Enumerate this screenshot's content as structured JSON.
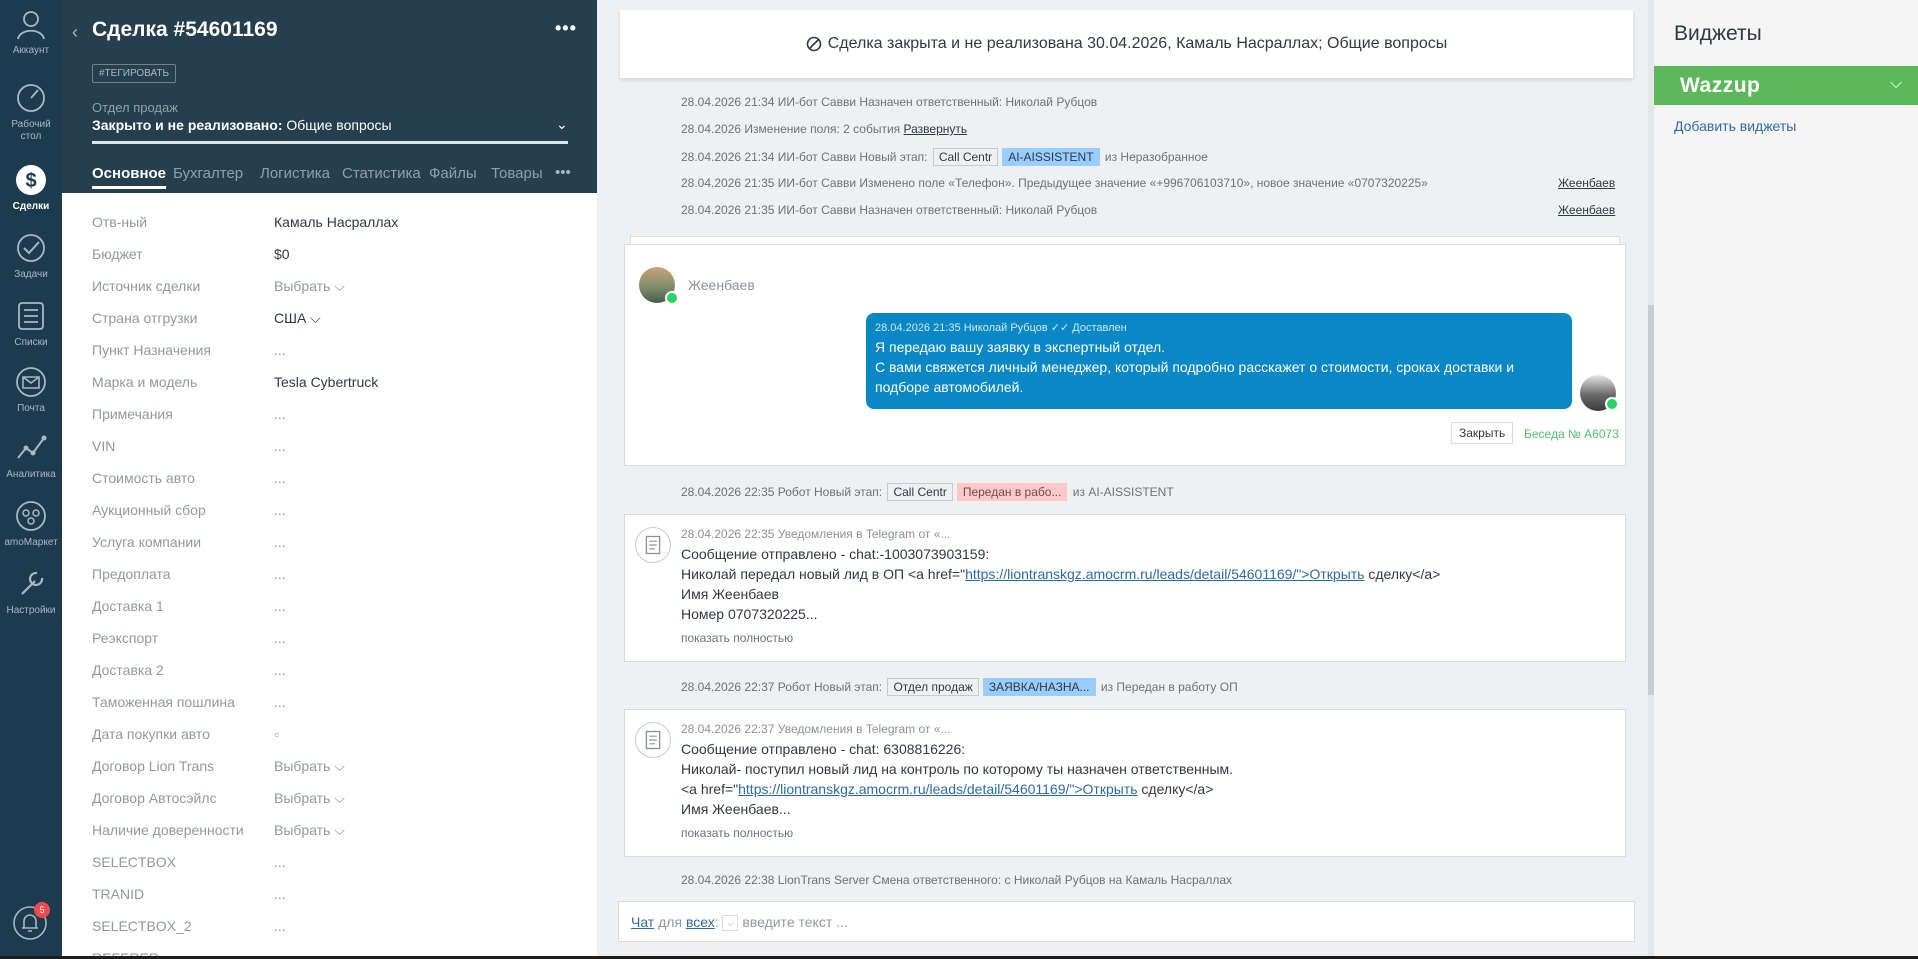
{
  "nav": {
    "items": [
      {
        "label": "Аккаунт",
        "icon": "account-icon"
      },
      {
        "label": "Рабочий стол",
        "icon": "dashboard-icon"
      },
      {
        "label": "Сделки",
        "icon": "deals-icon"
      },
      {
        "label": "Задачи",
        "icon": "tasks-icon"
      },
      {
        "label": "Списки",
        "icon": "lists-icon"
      },
      {
        "label": "Почта",
        "icon": "mail-icon"
      },
      {
        "label": "Аналитика",
        "icon": "analytics-icon"
      },
      {
        "label": "amoМаркет",
        "icon": "market-icon"
      },
      {
        "label": "Настройки",
        "icon": "settings-icon"
      }
    ],
    "notifications_count": "5"
  },
  "card": {
    "title": "Сделка #54601169",
    "tag_button": "#ТЕГИРОВАТЬ",
    "pipeline_label": "Отдел продаж",
    "status_bold": "Закрыто и не реализовано:",
    "status_rest": " Общие вопросы",
    "tabs": [
      "Основное",
      "Бухгалтер",
      "Логистика",
      "Статистика",
      "Файлы",
      "Товары"
    ],
    "fields": [
      {
        "label": "Отв-ный",
        "value": "Камаль Насраллах"
      },
      {
        "label": "Бюджет",
        "value": "$0"
      },
      {
        "label": "Источник сделки",
        "value": "Выбрать ⌵"
      },
      {
        "label": "Страна отгрузки",
        "value": "США ⌵"
      },
      {
        "label": "Пункт Назначения",
        "value": "..."
      },
      {
        "label": "Марка и модель",
        "value": "Tesla Cybertruck"
      },
      {
        "label": "Примечания",
        "value": "..."
      },
      {
        "label": "VIN",
        "value": "..."
      },
      {
        "label": "Стоимость авто",
        "value": "..."
      },
      {
        "label": "Аукционный сбор",
        "value": "..."
      },
      {
        "label": "Услуга компании",
        "value": "..."
      },
      {
        "label": "Предоплата",
        "value": "..."
      },
      {
        "label": "Доставка 1",
        "value": "..."
      },
      {
        "label": "Реэкспорт",
        "value": "..."
      },
      {
        "label": "Доставка 2",
        "value": "..."
      },
      {
        "label": "Таможенная пошлина",
        "value": "..."
      },
      {
        "label": "Дата покупки авто",
        "value": "▫"
      },
      {
        "label": "Договор Lion Trans",
        "value": "Выбрать ⌵"
      },
      {
        "label": "Договор Автосэйлс",
        "value": "Выбрать ⌵"
      },
      {
        "label": "Наличие доверенности",
        "value": "Выбрать ⌵"
      },
      {
        "label": "SELECTBOX",
        "value": "..."
      },
      {
        "label": "TRANID",
        "value": "..."
      },
      {
        "label": "SELECTBOX_2",
        "value": "..."
      },
      {
        "label": "REFERER",
        "value": ""
      }
    ]
  },
  "feed": {
    "banner": "Сделка закрыта и не реализована 30.04.2026, Камаль Насраллах; Общие вопросы",
    "log1": "28.04.2026 21:34 ИИ-бот Савви Назначен ответственный: Николай Рубцов",
    "log2_text": "28.04.2026 Изменение поля: 2 события ",
    "log2_link": "Развернуть",
    "log3_pre": "28.04.2026 21:34 ИИ-бот Савви Новый этап: ",
    "log3_chip1": "Call Centr",
    "log3_chip2": "AI-AISSISTENT",
    "log3_post": " из Неразобранное",
    "log4": "28.04.2026 21:35 ИИ-бот Савви Изменено поле «Телефон». Предыдущее значение «+996706103710», новое значение «0707320225»",
    "log4_author": "Жеенбаев",
    "log5": "28.04.2026 21:35 ИИ-бот Савви Назначен ответственный: Николай Рубцов",
    "log5_author": "Жеенбаев",
    "chat": {
      "contact_name": "Жеенбаев",
      "header": "28.04.2026 21:35 Николай Рубцов ✓✓ Доставлен",
      "line1": "Я передаю вашу заявку в экспертный отдел.",
      "line2": "С вами свяжется личный менеджер, который подробно расскажет о стоимости, сроках доставки и",
      "line3": "подборе автомобилей.",
      "close_button": "Закрыть",
      "conversation": "Беседа № А6073"
    },
    "log6_pre": "28.04.2026 22:35 Робот Новый этап: ",
    "log6_chip1": "Call Centr",
    "log6_chip2": "Передан в рабо...",
    "log6_post": " из AI-AISSISTENT",
    "note1": {
      "head": "28.04.2026 22:35 Уведомления в Telegram от «...",
      "l1": "Сообщение отправлено - chat:-1003073903159:",
      "l2_pre": "Николай передал новый лид в ОП <a href=\"",
      "l2_url": "https://liontranskgz.amocrm.ru/leads/detail/54601169/\">Открыть",
      "l2_post": " сделку</a>",
      "l3": "Имя Жеенбаев",
      "l4": "Номер 0707320225...",
      "more": "показать полностью"
    },
    "log7_pre": "28.04.2026 22:37 Робот Новый этап: ",
    "log7_chip1": "Отдел продаж",
    "log7_chip2": "ЗАЯВКА/НАЗНА...",
    "log7_post": " из Передан в работу ОП",
    "note2": {
      "head": "28.04.2026 22:37 Уведомления в Telegram от «...",
      "l1": "Сообщение отправлено - chat: 6308816226:",
      "l2": "Николай- поступил новый лид на контроль по которому ты назначен ответственным.",
      "l3_pre": "<a href=\"",
      "l3_url": "https://liontranskgz.amocrm.ru/leads/detail/54601169/\">Открыть",
      "l3_post": " сделку</a>",
      "l4": "Имя Жеенбаев...",
      "more": "показать полностью"
    },
    "log8": "28.04.2026 22:38 LionTrans Server Смена ответственного: с Николай Рубцов на Камаль Насраллах",
    "composer": {
      "chat": "Чат",
      "for": " для ",
      "all": "всех",
      "colon": ":",
      "placeholder": "введите текст ..."
    }
  },
  "widgets": {
    "title": "Виджеты",
    "wazzup": "Wazzup",
    "add": "Добавить виджеты"
  },
  "colors": {
    "nav_bg": "#1d3b4f",
    "card_head": "#253f4f",
    "bubble": "#0a88c5",
    "wazzup": "#5db85c",
    "chip_blue": "#99ccff",
    "chip_red": "#ffc8c8"
  }
}
